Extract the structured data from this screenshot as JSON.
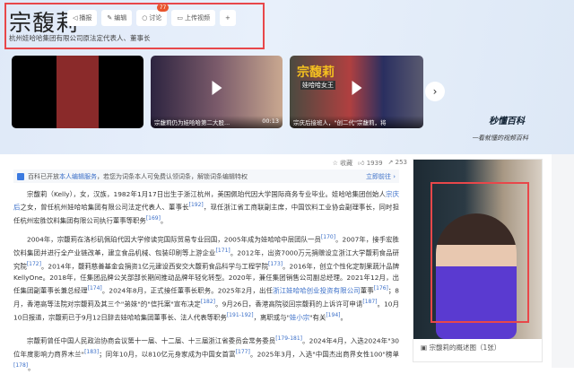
{
  "header": {
    "title": "宗馥莉",
    "subtitle": "杭州娃哈哈集团有限公司原法定代表人、董事长",
    "buttons": [
      {
        "label": "播报",
        "icon": "speaker-icon"
      },
      {
        "label": "编辑",
        "icon": "pencil-icon"
      },
      {
        "label": "讨论",
        "icon": "chat-icon",
        "badge": "77"
      },
      {
        "label": "上传视频",
        "icon": "video-icon"
      },
      {
        "label": "+",
        "icon": "plus-icon"
      }
    ]
  },
  "videos": [
    {
      "caption": ""
    },
    {
      "caption": "宗馥莉仍为娃哈哈第二大股...",
      "duration": "00:13"
    },
    {
      "caption": "宗庆后接班人，\"创二代\"宗馥莉，将",
      "overlay_title": "宗馥莉",
      "overlay_sub": "娃哈哈女王"
    }
  ],
  "brand": {
    "logo": "秒懂百科",
    "tagline": "一看就懂的视频百科"
  },
  "stats": {
    "favorite": "收藏",
    "likes": "1939",
    "shares": "253"
  },
  "notice": {
    "prefix": "百科已开放",
    "link": "本人编辑服务",
    "rest": "，若您为词条本人可免费认领词条，解锁词条编辑特权",
    "action": "立即前往 ›"
  },
  "paragraphs": [
    {
      "segments": [
        "宗馥莉（Kelly），女，汉族，1982年1月17日出生于浙江杭州，美国佩珀代因大学国际商务专业毕业。娃哈哈集团创始人",
        "宗庆后",
        "之女，曾任杭州娃哈哈集团有限公司法定代表人、董事长",
        "[192]",
        "，现任浙江省工商联副主席，中国饮料工业协会副理事长，同时担任杭州宏胜饮料集团有限公司执行董事等职务",
        "[169]",
        "。"
      ]
    },
    {
      "segments": [
        "2004年，宗馥莉在洛杉矶佩珀代因大学修读完国际贸易专业回国，2005年成为娃哈哈中层团队一员",
        "[170]",
        "。2007年，接手宏胜饮料集团并进行全产业链改革，建立食品机械、包装印刷等上游企业",
        "[171]",
        "。2012年，出资7000万元捐赠设立浙江大学馥莉食品研究院",
        "[172]",
        "。2014年，馥莉慈善基金会捐资1亿元建设西安交大馥莉食品科学与工程学院",
        "[173]",
        "。2016年，创立个性化定制果蔬汁品牌KellyOne。2018年，任集团品牌公关部部长期间推动品牌年轻化转型。2020年，兼任集团销售公司副总经理。2021年12月，出任集团副董事长兼总经理",
        "[174]",
        "。2024年8月，正式接任董事长职务。2025年2月，出任",
        "浙江娃哈哈创业投资有限公司",
        "董事",
        "[176]",
        "；8月，香港高等法院对宗馥莉及其三个\"弟妹\"的\"信托案\"宣布决定",
        "[182]",
        "。9月26日，香港高院驳回宗馥莉的上诉许可申请",
        "[187]",
        "。10月10日报道，宗馥莉已于9月12日辞去娃哈哈集团董事长、法人代表等职务",
        "[191-192]",
        "，离职或与\"",
        "娃小宗",
        "\"有关",
        "[194]",
        "。"
      ]
    },
    {
      "segments": [
        "宗馥莉曾任中国人民政治协商会议第十一届、十二届、十三届浙江省委员会常务委员",
        "[179-181]",
        "。2024年4月，入选2024年\"30位年度影响力商界木兰\"",
        "[183]",
        "；同年10月，以810亿元身家成为中国女首富",
        "[177]",
        "。2025年3月，入选\"中国杰出商界女性100\"榜单",
        "[178]",
        "。"
      ]
    }
  ],
  "image_panel": {
    "caption": "宗馥莉的概述图（1张）"
  }
}
